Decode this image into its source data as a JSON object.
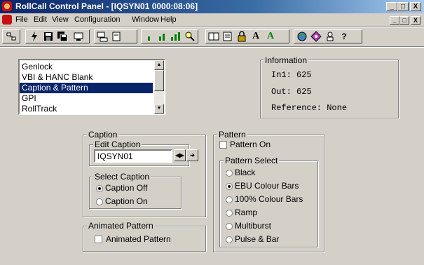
{
  "window": {
    "title": "RollCall Control Panel - [IQSYN01 0000:08:06]",
    "min_label": "_",
    "max_label": "□",
    "close_label": "X"
  },
  "menu": {
    "items": [
      "File",
      "Edit",
      "View",
      "Configuration",
      "Window",
      "Help"
    ]
  },
  "toolbar": {
    "font_a_label": "A",
    "font_a_green_label": "A",
    "help_label": "?"
  },
  "listbox": {
    "items": [
      {
        "label": "Genlock",
        "selected": false
      },
      {
        "label": "VBI & HANC Blank",
        "selected": false
      },
      {
        "label": "Caption & Pattern",
        "selected": true
      },
      {
        "label": "GPI",
        "selected": false
      },
      {
        "label": "RollTrack",
        "selected": false
      }
    ]
  },
  "information": {
    "title": "Information",
    "in1": "In1: 625",
    "out": "Out: 625",
    "reference": "Reference: None"
  },
  "caption": {
    "title": "Caption",
    "edit_title": "Edit Caption",
    "edit_value": "IQSYN01",
    "select_title": "Select Caption",
    "options": [
      {
        "label": "Caption Off",
        "checked": true
      },
      {
        "label": "Caption On",
        "checked": false
      }
    ]
  },
  "animated": {
    "title": "Animated Pattern",
    "checkbox_label": "Animated Pattern",
    "checked": false
  },
  "pattern": {
    "title": "Pattern",
    "pattern_on_label": "Pattern On",
    "pattern_on_checked": false,
    "select_title": "Pattern Select",
    "options": [
      {
        "label": "Black",
        "checked": false
      },
      {
        "label": "EBU Colour Bars",
        "checked": true
      },
      {
        "label": "100% Colour Bars",
        "checked": false
      },
      {
        "label": "Ramp",
        "checked": false
      },
      {
        "label": "Multiburst",
        "checked": false
      },
      {
        "label": "Pulse & Bar",
        "checked": false
      }
    ]
  },
  "colors": {
    "title_bar": "#0a246a",
    "selection": "#0a246a",
    "face": "#d4d0c8"
  }
}
